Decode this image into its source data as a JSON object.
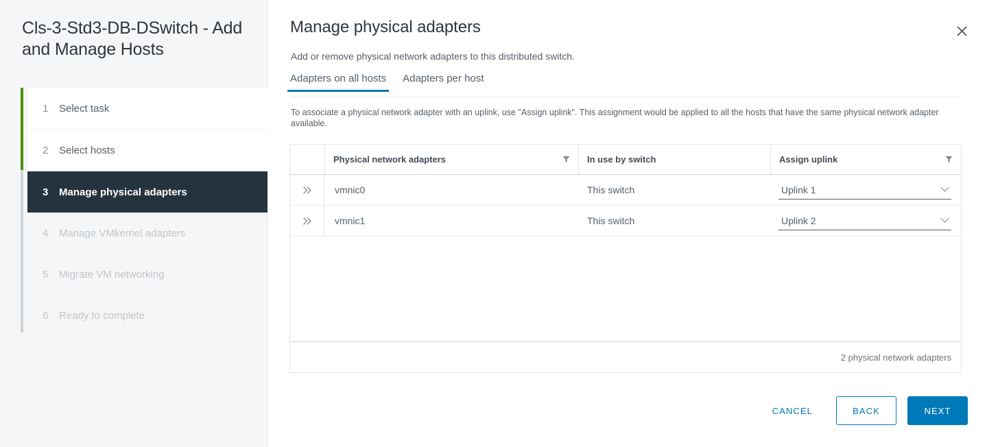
{
  "wizard": {
    "title": "Cls-3-Std3-DB-DSwitch - Add and Manage Hosts",
    "steps": [
      {
        "num": "1",
        "label": "Select task",
        "state": "done"
      },
      {
        "num": "2",
        "label": "Select hosts",
        "state": "done"
      },
      {
        "num": "3",
        "label": "Manage physical adapters",
        "state": "active"
      },
      {
        "num": "4",
        "label": "Manage VMkernel adapters",
        "state": "future"
      },
      {
        "num": "5",
        "label": "Migrate VM networking",
        "state": "future"
      },
      {
        "num": "6",
        "label": "Ready to complete",
        "state": "future"
      }
    ]
  },
  "panel": {
    "title": "Manage physical adapters",
    "subtitle": "Add or remove physical network adapters to this distributed switch.",
    "close_icon": "close-icon",
    "instructions": "To associate a physical network adapter with an uplink, use \"Assign uplink\". This assignment would be applied to all the hosts that have the same physical network adapter available."
  },
  "tabs": [
    {
      "label": "Adapters on all hosts",
      "active": true
    },
    {
      "label": "Adapters per host",
      "active": false
    }
  ],
  "table": {
    "columns": [
      {
        "key": "expand",
        "label": "",
        "filter": false
      },
      {
        "key": "adapter",
        "label": "Physical network adapters",
        "filter": true
      },
      {
        "key": "inuse",
        "label": "In use by switch",
        "filter": false
      },
      {
        "key": "uplink",
        "label": "Assign uplink",
        "filter": true
      }
    ],
    "rows": [
      {
        "expand_icon": "expand-chevrons-icon",
        "adapter": "vmnic0",
        "inuse": "This switch",
        "uplink": "Uplink 1"
      },
      {
        "expand_icon": "expand-chevrons-icon",
        "adapter": "vmnic1",
        "inuse": "This switch",
        "uplink": "Uplink 2"
      }
    ],
    "footer_count": "2 physical network adapters"
  },
  "buttons": {
    "cancel": "CANCEL",
    "back": "BACK",
    "next": "NEXT"
  },
  "colors": {
    "accent_blue": "#0079b8",
    "progress_green": "#4a9100",
    "active_step_bg": "#25333f"
  }
}
